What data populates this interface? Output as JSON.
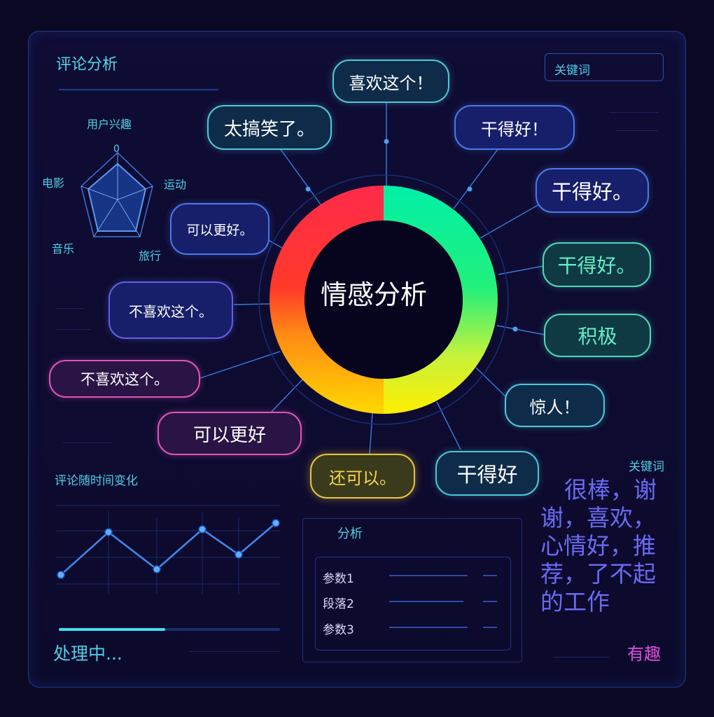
{
  "header": {
    "title": "评论分析",
    "keyword_label": "关键词"
  },
  "radar": {
    "title": "用户兴趣",
    "top_value": "0",
    "axes": [
      "运动",
      "旅行",
      "音乐",
      "电影"
    ]
  },
  "center": {
    "label": "情感分析"
  },
  "bubbles": [
    {
      "text": "喜欢这个！"
    },
    {
      "text": "太搞笑了。"
    },
    {
      "text": "干得好！"
    },
    {
      "text": "干得好。"
    },
    {
      "text": "可以更好。"
    },
    {
      "text": "干得好。"
    },
    {
      "text": "不喜欢这个。"
    },
    {
      "text": "积极"
    },
    {
      "text": "不喜欢这个。"
    },
    {
      "text": "惊人！"
    },
    {
      "text": "可以更好"
    },
    {
      "text": "还可以。"
    },
    {
      "text": "干得好"
    }
  ],
  "donut_colors": {
    "positive": "#00f0b0",
    "neutral": "#ffee00",
    "negative": "#ff2a4a"
  },
  "line_chart": {
    "title": "评论随时间变化"
  },
  "status": {
    "label": "处理中...",
    "progress": 0.48
  },
  "analysis": {
    "title": "分析",
    "params": [
      "参数1",
      "段落2",
      "参数3"
    ]
  },
  "keywords_panel": {
    "title": "关键词",
    "text": "很棒，谢谢，喜欢，心情好，推荐，了不起的工作"
  },
  "tag": {
    "label": "有趣",
    "color": "#e04ee0"
  }
}
